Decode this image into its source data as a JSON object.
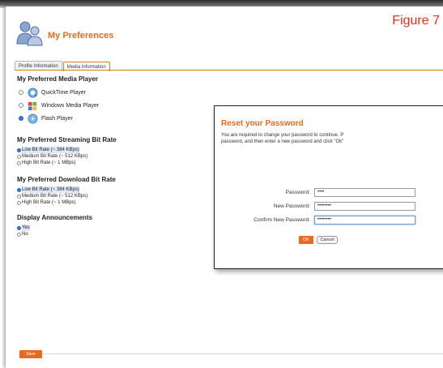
{
  "figure_label": "Figure 7",
  "header": {
    "title": "My Preferences",
    "icon": "users-icon"
  },
  "tabs": [
    {
      "label": "Profile Information",
      "active": false
    },
    {
      "label": "Media Information",
      "active": true
    }
  ],
  "media_player": {
    "title": "My Preferred Media Player",
    "options": [
      {
        "label": "QuickTime Player",
        "icon": "quicktime-icon",
        "selected": false
      },
      {
        "label": "Windows Media Player",
        "icon": "windows-media-icon",
        "selected": false
      },
      {
        "label": "Flash Player",
        "icon": "flash-icon",
        "selected": true
      }
    ]
  },
  "streaming_bitrate": {
    "title": "My Preferred Streaming Bit Rate",
    "options": [
      {
        "label": "Low Bit Rate (~ 384 KBps)",
        "selected": true
      },
      {
        "label": "Medium Bit Rate (~ 512 KBps)",
        "selected": false
      },
      {
        "label": "High Bit Rate (~ 1 MBps)",
        "selected": false
      }
    ]
  },
  "download_bitrate": {
    "title": "My Preferred Download Bit Rate",
    "options": [
      {
        "label": "Low Bit Rate (~ 384 KBps)",
        "selected": true
      },
      {
        "label": "Medium Bit Rate (~ 512 KBps)",
        "selected": false
      },
      {
        "label": "High Bit Rate (~ 1 MBps)",
        "selected": false
      }
    ]
  },
  "announcements": {
    "title": "Display Announcements",
    "options": [
      {
        "label": "Yes",
        "selected": true
      },
      {
        "label": "No",
        "selected": false
      }
    ]
  },
  "save_label": "Save",
  "dialog": {
    "title": "Reset your Password",
    "desc_line1": "You are required to change your password to continue. P",
    "desc_line2": "password, and then enter a new password and click \"Ok\"",
    "fields": [
      {
        "label": "Password:",
        "value": "••••"
      },
      {
        "label": "New Password:",
        "value": "••••••••"
      },
      {
        "label": "Confirm New Password:",
        "value": "••••••••"
      }
    ],
    "ok_label": "OK",
    "cancel_label": "Cancel"
  },
  "colors": {
    "accent": "#e96a1c",
    "radio_selected": "#2f7fe0",
    "figure_label": "#e0301e"
  }
}
